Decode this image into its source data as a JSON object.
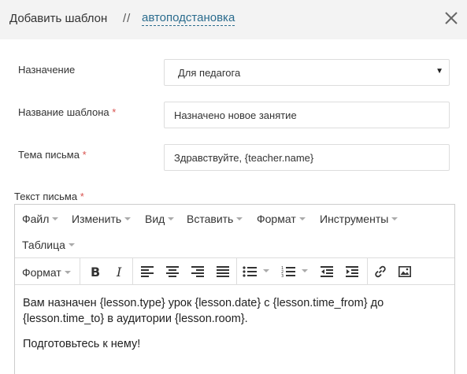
{
  "header": {
    "title": "Добавить шаблон",
    "separator": "//",
    "link": "автоподстановка"
  },
  "form": {
    "purpose": {
      "label": "Назначение",
      "value": "Для педагога"
    },
    "template_name": {
      "label": "Название шаблона",
      "required": "*",
      "value": "Назначено новое занятие"
    },
    "subject": {
      "label": "Тема письма",
      "required": "*",
      "value": "Здравствуйте, {teacher.name}"
    },
    "body": {
      "label": "Текст письма",
      "required": "*"
    }
  },
  "editor": {
    "menu": [
      "Файл",
      "Изменить",
      "Вид",
      "Вставить",
      "Формат",
      "Инструменты"
    ],
    "menu2": [
      "Таблица"
    ],
    "format_label": "Формат",
    "content": [
      "Вам назначен {lesson.type} урок {lesson.date} с {lesson.time_from} до {lesson.time_to} в аудитории {lesson.room}.",
      "Подготовьтесь к нему!"
    ]
  }
}
